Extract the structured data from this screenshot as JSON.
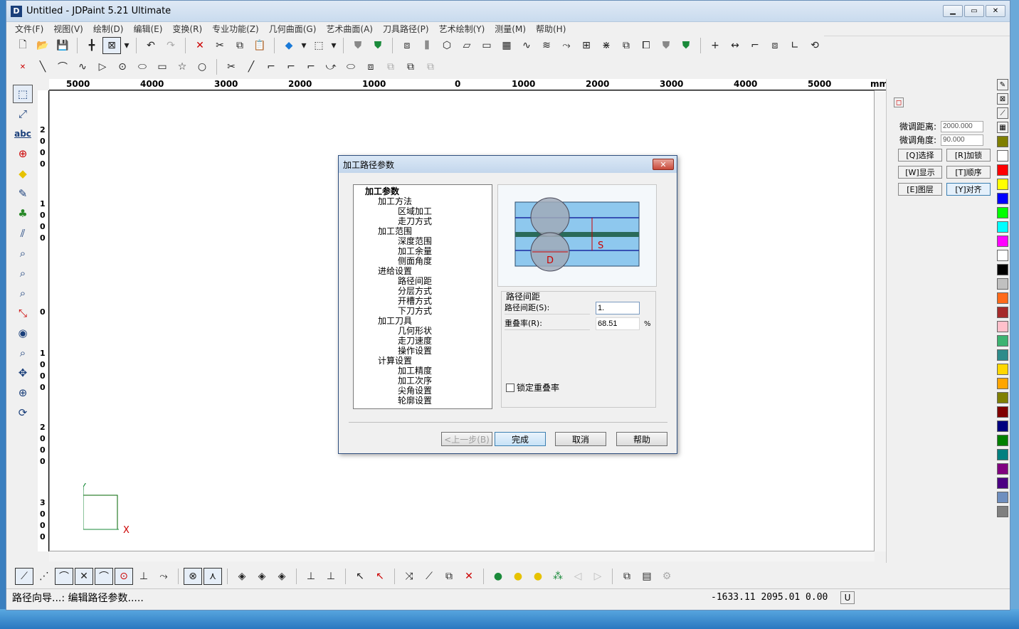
{
  "window": {
    "title": "Untitled - JDPaint 5.21 Ultimate",
    "app_icon": "D"
  },
  "menu": [
    "文件(F)",
    "视图(V)",
    "绘制(D)",
    "编辑(E)",
    "变换(R)",
    "专业功能(Z)",
    "几何曲面(G)",
    "艺术曲面(A)",
    "刀具路径(P)",
    "艺术绘制(Y)",
    "测量(M)",
    "帮助(H)"
  ],
  "ruler": {
    "top_labels": [
      "5000",
      "4000",
      "3000",
      "2000",
      "1000",
      "0",
      "1000",
      "2000",
      "3000",
      "4000",
      "5000"
    ],
    "unit": "mm",
    "left_labels": [
      "2000",
      "1000",
      "0",
      "1000",
      "2000",
      "3000"
    ]
  },
  "right_panel": {
    "dist_label": "微调距离:",
    "dist_value": "2000.000",
    "angle_label": "微调角度:",
    "angle_value": "90.000",
    "buttons": [
      "[Q]选择",
      "[R]加锁",
      "[W]显示",
      "[T]顺序",
      "[E]图层",
      "[Y]对齐"
    ]
  },
  "palette": [
    "#7f7f00",
    "#ffffff",
    "#ff0000",
    "#ffff00",
    "#0000ff",
    "#00ff00",
    "#00ffff",
    "#ff00ff",
    "#ffffff",
    "#000000",
    "#c0c0c0",
    "#ff6a1a",
    "#a52a2a",
    "#ffc0cb",
    "#3cb371",
    "#2e8b8b",
    "#ffd700",
    "#ffa500",
    "#808000",
    "#800000",
    "#000080",
    "#008000",
    "#008080",
    "#800080",
    "#4b0082",
    "#6f8fbf",
    "#808080"
  ],
  "status": {
    "left": "路径向导...: 编辑路径参数.....",
    "coords": "-1633.11 2095.01 0.00",
    "mode": "U"
  },
  "dialog": {
    "title": "加工路径参数",
    "tree": [
      {
        "level": 0,
        "label": "加工参数"
      },
      {
        "level": 1,
        "label": "加工方法"
      },
      {
        "level": 2,
        "label": "区域加工"
      },
      {
        "level": 2,
        "label": "走刀方式"
      },
      {
        "level": 1,
        "label": "加工范围"
      },
      {
        "level": 2,
        "label": "深度范围"
      },
      {
        "level": 2,
        "label": "加工余量"
      },
      {
        "level": 2,
        "label": "侧面角度"
      },
      {
        "level": 1,
        "label": "进给设置"
      },
      {
        "level": 2,
        "label": "路径间距"
      },
      {
        "level": 2,
        "label": "分层方式"
      },
      {
        "level": 2,
        "label": "开槽方式"
      },
      {
        "level": 2,
        "label": "下刀方式"
      },
      {
        "level": 1,
        "label": "加工刀具"
      },
      {
        "level": 2,
        "label": "几何形状"
      },
      {
        "level": 2,
        "label": "走刀速度"
      },
      {
        "level": 2,
        "label": "操作设置"
      },
      {
        "level": 1,
        "label": "计算设置"
      },
      {
        "level": 2,
        "label": "加工精度"
      },
      {
        "level": 2,
        "label": "加工次序"
      },
      {
        "level": 2,
        "label": "尖角设置"
      },
      {
        "level": 2,
        "label": "轮廓设置"
      }
    ],
    "preview_s": "S",
    "preview_d": "D",
    "group_title": "路径间距",
    "spacing_label": "路径间距(S):",
    "spacing_value": "1.",
    "overlap_label": "重叠率(R):",
    "overlap_value": "68.51",
    "overlap_unit": "%",
    "lock_label": "锁定重叠率",
    "btn_prev": "<上一步(B)",
    "btn_finish": "完成",
    "btn_cancel": "取消",
    "btn_help": "帮助"
  },
  "axis": {
    "x": "X",
    "y": "Y"
  }
}
